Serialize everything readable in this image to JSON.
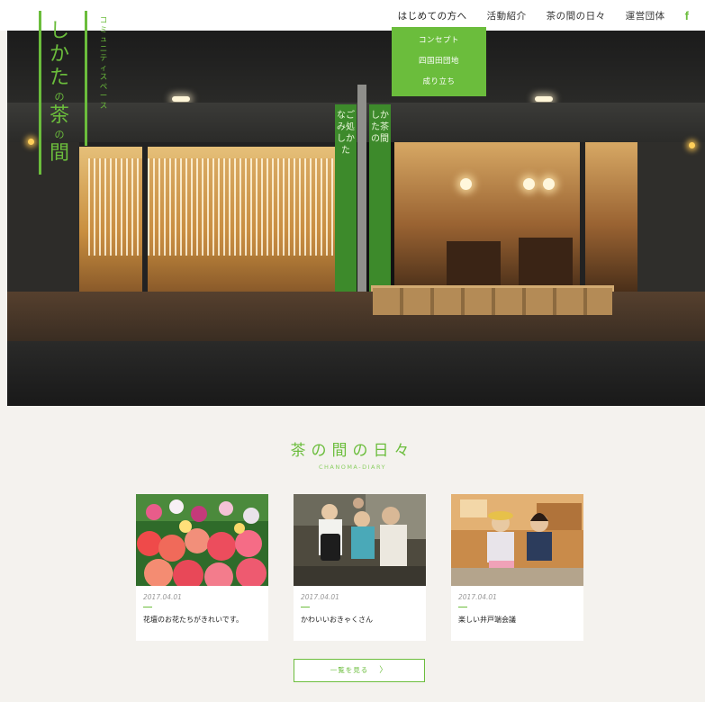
{
  "logo": {
    "main_top": "しかた",
    "main_small1": "の",
    "main_mid": "茶",
    "main_small2": "の",
    "main_bottom": "間",
    "sub": "コミュニティスペース",
    "color": "#6bbd3c"
  },
  "nav": {
    "items": [
      "はじめての方へ",
      "活動紹介",
      "茶の間の日々",
      "運営団体"
    ],
    "facebook": "f",
    "dropdown": [
      "コンセプト",
      "四国田団地",
      "成り立ち"
    ]
  },
  "hero": {
    "banner_left": "なごみ処しかた",
    "banner_right": "しかた茶の間"
  },
  "diary": {
    "title": "茶の間の日々",
    "subtitle": "CHANOMA-DIARY",
    "cards": [
      {
        "date": "2017.04.01",
        "title": "花壇のお花たちがきれいです。"
      },
      {
        "date": "2017.04.01",
        "title": "かわいいおきゃくさん"
      },
      {
        "date": "2017.04.01",
        "title": "楽しい井戸端会議"
      }
    ],
    "more_label": "一覧を見る",
    "more_arrow": "〉"
  },
  "colors": {
    "accent": "#6bbd3c",
    "background": "#f4f2ee"
  }
}
